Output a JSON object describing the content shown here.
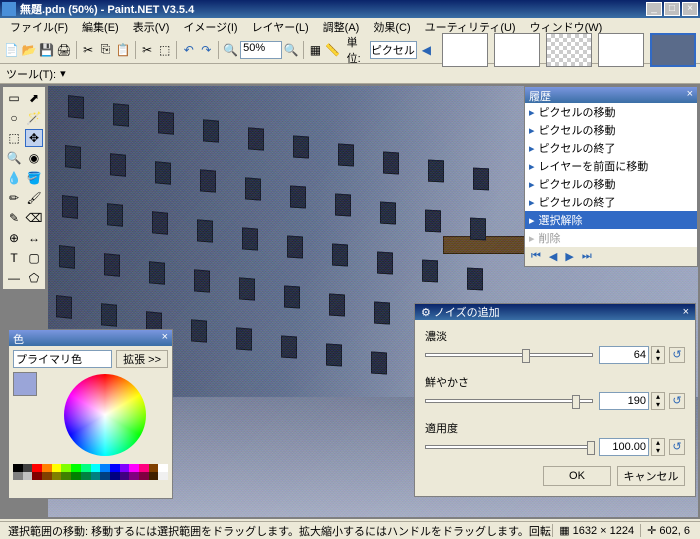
{
  "title": "無題.pdn (50%) - Paint.NET V3.5.4",
  "menu": [
    "ファイル(F)",
    "編集(E)",
    "表示(V)",
    "イメージ(I)",
    "レイヤー(L)",
    "調整(A)",
    "効果(C)",
    "ユーティリティ(U)",
    "ウィンドウ(W)"
  ],
  "toolbar": {
    "zoom": "50%",
    "unit_label": "単位:",
    "unit": "ピクセル"
  },
  "tool_row2": "ツール(T): ",
  "history": {
    "title": "履歴",
    "items": [
      "ピクセルの移動",
      "ピクセルの移動",
      "ピクセルの終了",
      "レイヤーを前面に移動",
      "ピクセルの移動",
      "ピクセルの終了",
      "選択解除"
    ],
    "disabled": "削除",
    "selected_index": 6
  },
  "colors": {
    "title": "色",
    "mode": "プライマリ色",
    "more": "拡張 >>",
    "primary": "#9aa5d8",
    "secondary": "#ffffff",
    "palette": [
      "#000",
      "#404040",
      "#f00",
      "#ff8000",
      "#ff0",
      "#80ff00",
      "#0f0",
      "#00ff80",
      "#0ff",
      "#0080ff",
      "#00f",
      "#8000ff",
      "#f0f",
      "#ff0080",
      "#804000",
      "#fff",
      "#808080",
      "#c0c0c0",
      "#800000",
      "#804000",
      "#808000",
      "#408000",
      "#008000",
      "#008040",
      "#008080",
      "#004080",
      "#000080",
      "#400080",
      "#800080",
      "#800040",
      "#402000",
      "#f0f0f0"
    ]
  },
  "noise_dialog": {
    "title": "ノイズの追加",
    "intensity_label": "濃淡",
    "intensity": "64",
    "saturation_label": "鮮やかさ",
    "saturation": "190",
    "coverage_label": "適用度",
    "coverage": "100.00",
    "ok": "OK",
    "cancel": "キャンセル"
  },
  "status": {
    "msg": "選択範囲の移動: 移動するには選択範囲をドラッグします。拡大縮小するにはハンドルをドラッグします。回転するにはマウスの右ボタンでドラッグ",
    "dims": "1632 × 1224",
    "pos": "602, 6"
  }
}
